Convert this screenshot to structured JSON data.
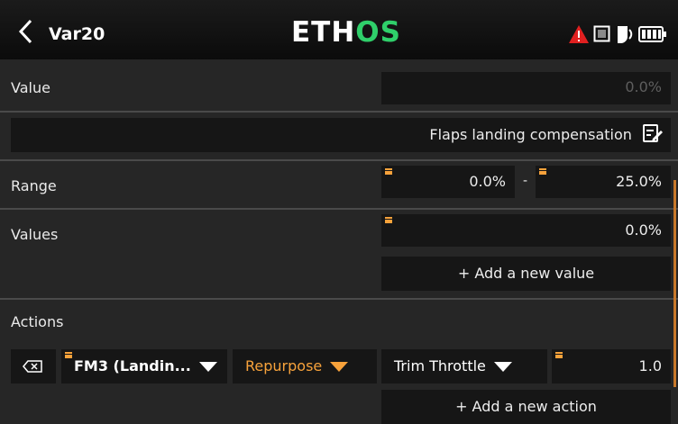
{
  "header": {
    "title": "Var20",
    "logo_left": "ETH",
    "logo_right": "OS"
  },
  "value_row": {
    "label": "Value",
    "value": "0.0%"
  },
  "name_row": {
    "value": "Flaps landing compensation"
  },
  "range_row": {
    "label": "Range",
    "min": "0.0%",
    "dash": "-",
    "max": "25.0%"
  },
  "values_row": {
    "label": "Values",
    "value": "0.0%",
    "add_label": "+ Add a new value"
  },
  "actions": {
    "label": "Actions",
    "condition": "FM3 (Landin...",
    "mode": "Repurpose",
    "target": "Trim Throttle",
    "amount": "1.0",
    "add_label": "+ Add a new action"
  },
  "colors": {
    "accent": "#f7a23b",
    "logo_green": "#2fcf6a",
    "warning_red": "#e02020",
    "field_bg": "#161616",
    "page_bg": "#262626"
  },
  "icons": [
    "back-chevron-icon",
    "warning-icon",
    "checkbox-icon",
    "sound-icon",
    "battery-icon",
    "edit-icon",
    "delete-icon",
    "dropdown-arrow-icon"
  ]
}
